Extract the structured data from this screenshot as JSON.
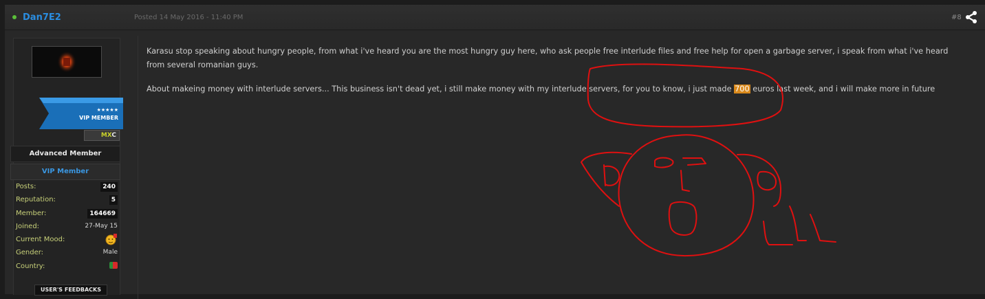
{
  "post": {
    "author": "Dan7E2",
    "posted": "Posted 14 May 2016 - 11:40 PM",
    "post_number": "#8"
  },
  "profile": {
    "ribbon_stars": "★★★★★",
    "ribbon_text": "VIP MEMBER",
    "badge": {
      "mx": "MX",
      "c": "C"
    },
    "rank": "Advanced Member",
    "group": "VIP Member",
    "stats": {
      "posts_label": "Posts:",
      "posts": "240",
      "reputation_label": "Reputation:",
      "reputation": "5",
      "member_label": "Member:",
      "member": "164669",
      "joined_label": "Joined:",
      "joined": "27-May 15",
      "mood_label": "Current Mood:",
      "gender_label": "Gender:",
      "gender": "Male",
      "country_label": "Country:"
    },
    "feedbacks": "USER'S FEEDBACKS"
  },
  "content": {
    "paragraph1": "Karasu stop speaking about hungry people, from what i've heard you are the most hungry guy here, who ask people free interlude files and free help for open a garbage server, i speak from what i've heard from several romanian guys.",
    "paragraph2_before": "About makeing money with interlude servers... This business isn't dead yet, i still make money with my interlude servers, for you to know, i just made ",
    "paragraph2_highlight": "700",
    "paragraph2_after": " euros last week, and i will make more in future"
  },
  "colors": {
    "author": "#2a8de0",
    "highlight": "#d9891c",
    "drawing": "#e01010",
    "online": "#5bbf3a"
  }
}
